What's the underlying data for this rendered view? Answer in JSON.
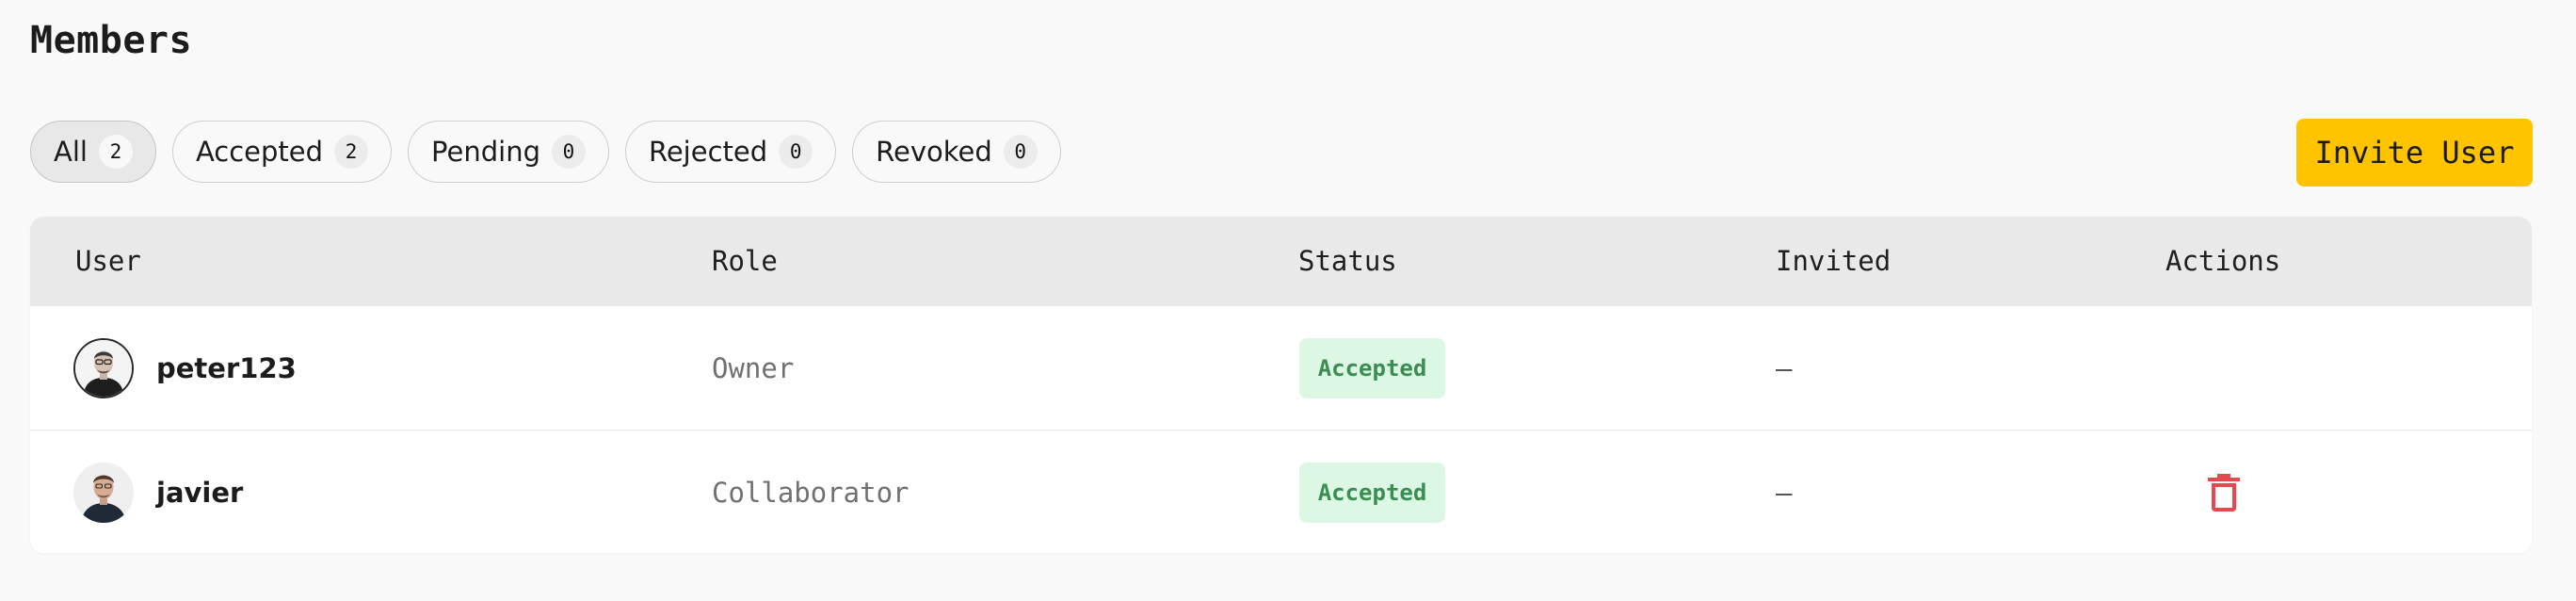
{
  "page": {
    "title": "Members"
  },
  "filters": [
    {
      "label": "All",
      "count": "2",
      "active": true
    },
    {
      "label": "Accepted",
      "count": "2",
      "active": false
    },
    {
      "label": "Pending",
      "count": "0",
      "active": false
    },
    {
      "label": "Rejected",
      "count": "0",
      "active": false
    },
    {
      "label": "Revoked",
      "count": "0",
      "active": false
    }
  ],
  "actions": {
    "invite_label": "Invite User",
    "invite_color": "#ffc400"
  },
  "table": {
    "headers": {
      "user": "User",
      "role": "Role",
      "status": "Status",
      "invited": "Invited",
      "actions": "Actions"
    },
    "rows": [
      {
        "username": "peter123",
        "role": "Owner",
        "status": "Accepted",
        "invited": "–",
        "avatar": "avatar-peter",
        "action_icon": ""
      },
      {
        "username": "javier",
        "role": "Collaborator",
        "status": "Accepted",
        "invited": "–",
        "avatar": "avatar-javier",
        "action_icon": "trash-icon"
      }
    ]
  },
  "colors": {
    "status_accepted_bg": "#dcf8e5",
    "status_accepted_text": "#3b8d53",
    "delete_red": "#e5484d"
  }
}
